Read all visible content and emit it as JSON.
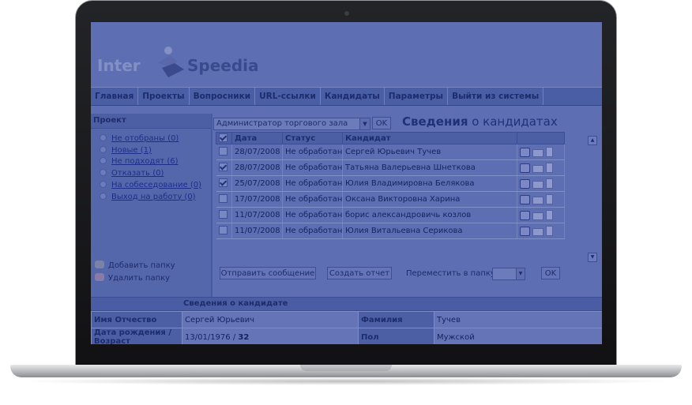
{
  "app": {
    "logo_left": "Inter",
    "logo_right": "Speedia"
  },
  "nav": {
    "items": [
      "Главная",
      "Проекты",
      "Вопросники",
      "URL-ссылки",
      "Кандидаты",
      "Параметры",
      "Выйти из системы"
    ]
  },
  "project_panel": {
    "header": "Проект",
    "folders": [
      "Не отобраны (0)",
      "Новые (1)",
      "Не подходят (6)",
      "Отказать (0)",
      "На собеседование (0)",
      "Выход на работу (0)"
    ],
    "add_folder": "Добавить папку",
    "delete_folder": "Удалить папку"
  },
  "toolbar": {
    "project_select_value": "Администратор торгового зала",
    "ok_label": "OK",
    "heading_bold": "Сведения",
    "heading_rest": " о кандидатах"
  },
  "candidates_table": {
    "columns": [
      "Дата",
      "Статус",
      "Кандидат"
    ],
    "rows": [
      {
        "checked": false,
        "date": "28/07/2008",
        "status": "Не обработан",
        "name": "Сергей Юрьевич Тучев"
      },
      {
        "checked": true,
        "date": "28/07/2008",
        "status": "Не обработан",
        "name": "Татьяна Валерьевна Шнеткова"
      },
      {
        "checked": true,
        "date": "25/07/2008",
        "status": "Не обработан",
        "name": "Юлия Владимировна Белякова"
      },
      {
        "checked": false,
        "date": "17/07/2008",
        "status": "Не обработан",
        "name": "Оксана Викторовна Харина"
      },
      {
        "checked": false,
        "date": "11/07/2008",
        "status": "Не обработан",
        "name": "борис александровичь козлов"
      },
      {
        "checked": false,
        "date": "11/07/2008",
        "status": "Не обработан",
        "name": "Юлия Витальевна Серикова"
      }
    ]
  },
  "actions": {
    "send_message": "Отправить сообщение",
    "create_report": "Создать отчет",
    "move_to_folder": "Переместить в папку",
    "ok_label": "OK"
  },
  "candidate_info": {
    "title": "Сведения о кандидате",
    "first_name_label": "Имя Отчество",
    "first_name_value": "Сергей Юрьевич",
    "last_name_label": "Фамилия",
    "last_name_value": "Тучев",
    "dob_label": "Дата рождения / Возраст",
    "dob_value": "13/01/1976",
    "age_value": "32",
    "dob_separator": " / ",
    "gender_label": "Пол",
    "gender_value": "Мужской"
  },
  "colors": {
    "screen_tint": "#5d6fb2",
    "navbar": "#4a5ea6",
    "logo_dark": "#3b4a8c",
    "bezel": "#18191c"
  },
  "icons": {
    "row_actions": [
      "view-icon",
      "mail-icon",
      "document-icon"
    ],
    "folder_bullet": "folder-bullet-icon"
  }
}
